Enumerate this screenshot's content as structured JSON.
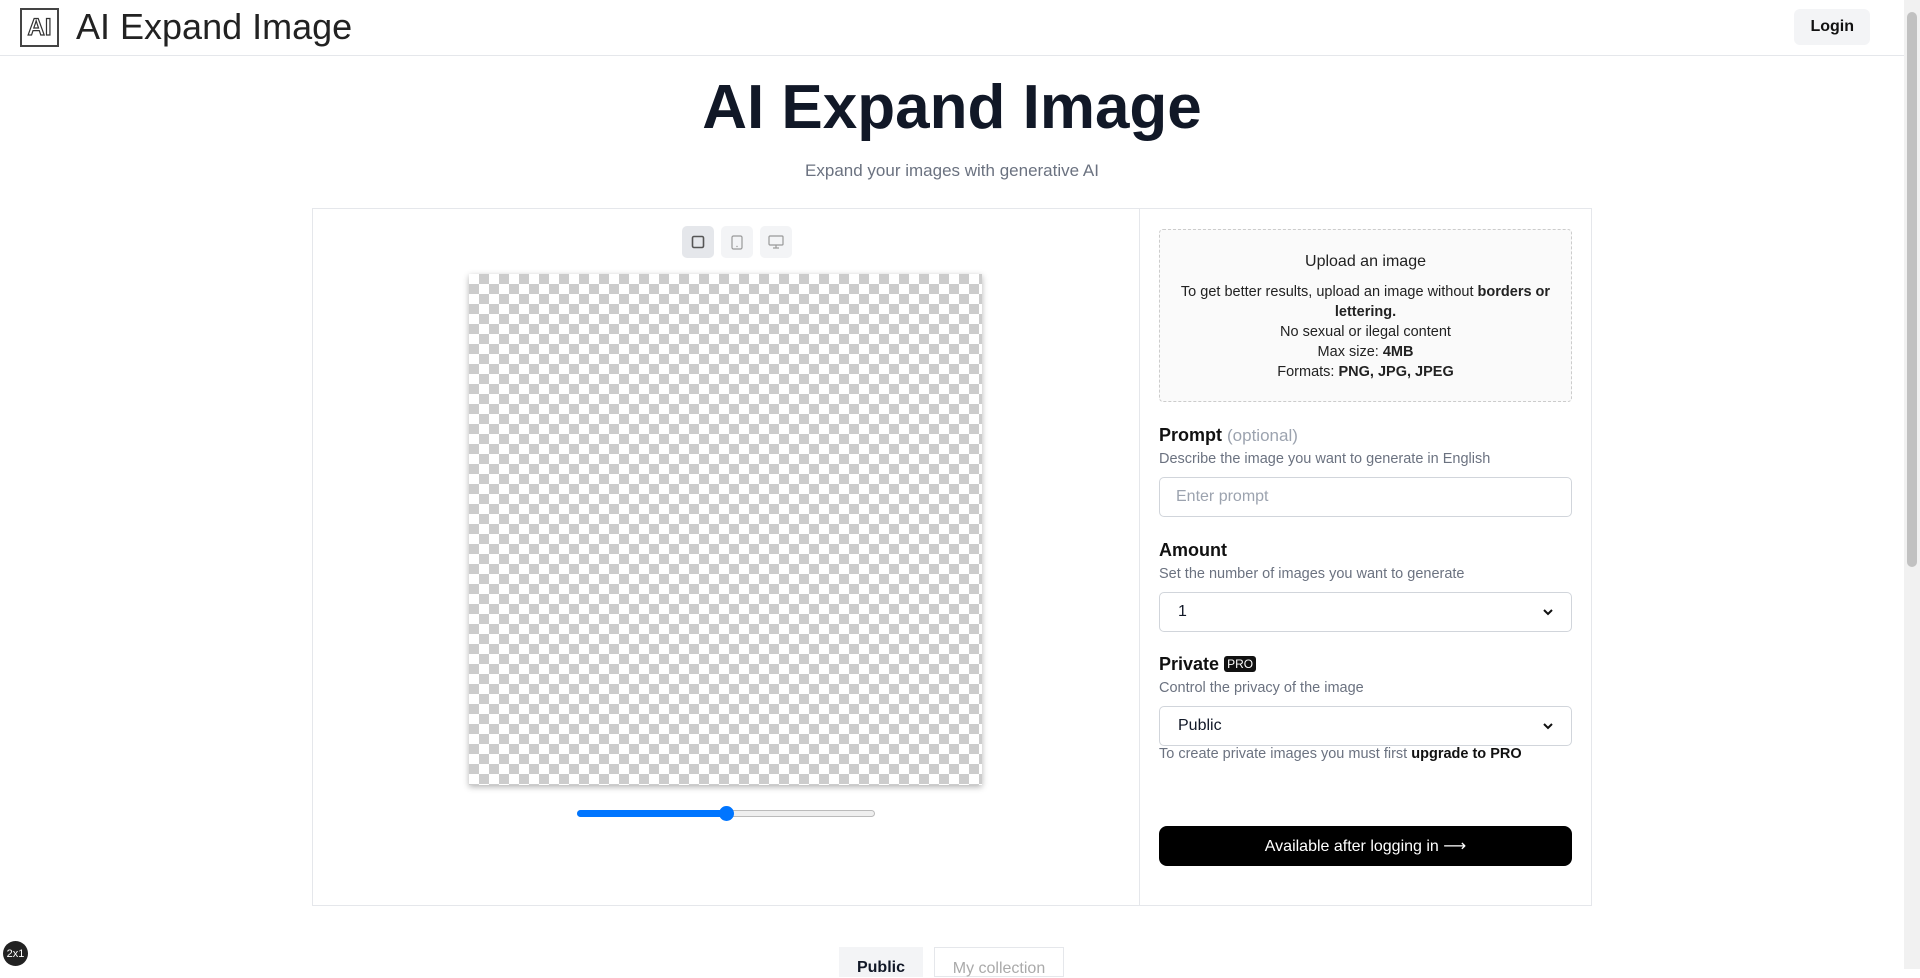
{
  "header": {
    "logo_text": "AI",
    "brand": "AI Expand Image",
    "login": "Login"
  },
  "hero": {
    "title": "AI Expand Image",
    "subtitle": "Expand your images with generative AI"
  },
  "editor": {
    "aspect_options": [
      "square-icon",
      "tablet-icon",
      "monitor-icon"
    ],
    "selected_aspect": "square",
    "zoom_slider_percent": 50
  },
  "upload": {
    "title": "Upload an image",
    "line1_pre": "To get better results, upload an image without ",
    "line1_bold": "borders or lettering.",
    "line2": "No sexual or ilegal content",
    "line3_pre": "Max size: ",
    "line3_bold": "4MB",
    "line4_pre": "Formats: ",
    "line4_bold": "PNG, JPG, JPEG"
  },
  "prompt": {
    "label": "Prompt",
    "optional": "(optional)",
    "desc": "Describe the image you want to generate in English",
    "placeholder": "Enter prompt",
    "value": ""
  },
  "amount": {
    "label": "Amount",
    "desc": "Set the number of images you want to generate",
    "value": "1"
  },
  "private": {
    "label": "Private",
    "badge": "PRO",
    "desc": "Control the privacy of the image",
    "value": "Public",
    "note_pre": "To create private images you must first ",
    "note_bold": "upgrade to PRO"
  },
  "submit": "Available after logging in ⟶",
  "gallery_tabs": [
    "Public",
    "My collection"
  ],
  "corner_badge": "2x1"
}
